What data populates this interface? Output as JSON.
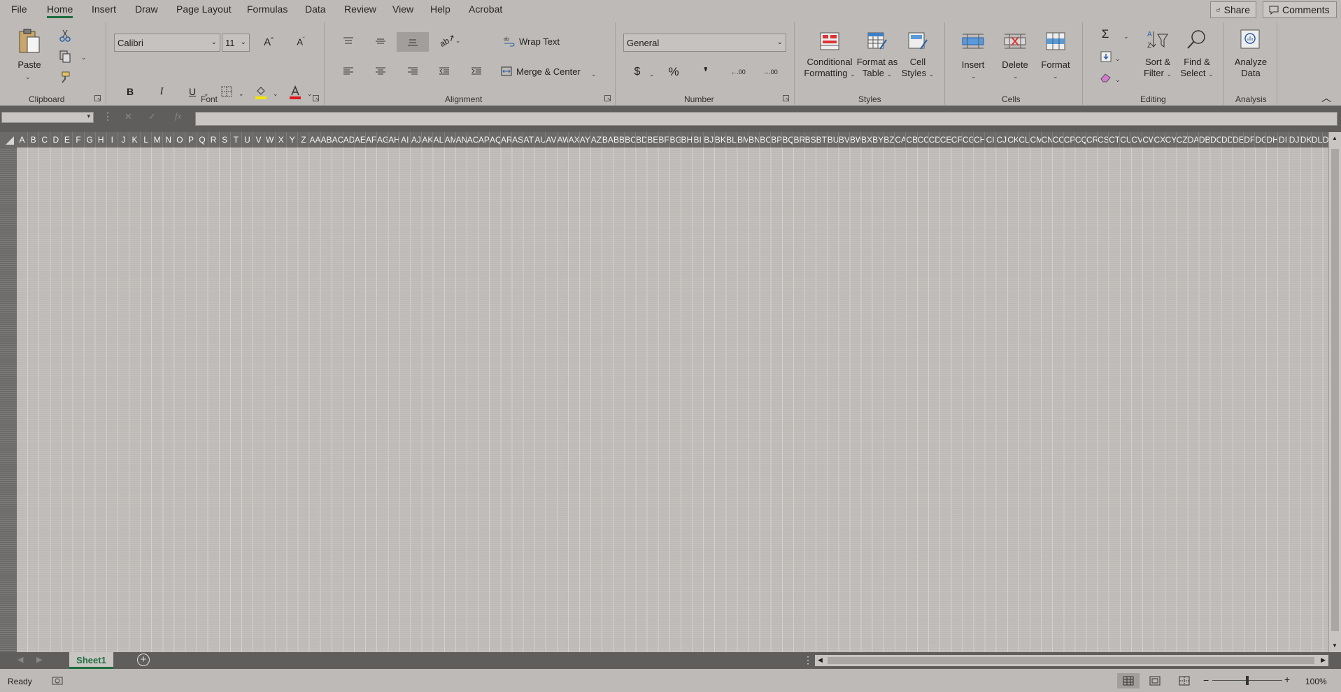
{
  "menu": {
    "tabs": [
      "File",
      "Home",
      "Insert",
      "Draw",
      "Page Layout",
      "Formulas",
      "Data",
      "Review",
      "View",
      "Help",
      "Acrobat"
    ],
    "share": "Share",
    "comments": "Comments"
  },
  "ribbon": {
    "clipboard": {
      "label": "Clipboard",
      "paste": "Paste"
    },
    "font": {
      "label": "Font",
      "name": "Calibri",
      "size": "11",
      "bold": "B",
      "italic": "I",
      "underline": "U",
      "highlight_color": "#f2e600",
      "font_color": "#e0191c"
    },
    "alignment": {
      "label": "Alignment",
      "wrap_text": "Wrap Text",
      "merge_center": "Merge & Center"
    },
    "number": {
      "label": "Number",
      "format": "General",
      "dollar": "$",
      "percent": "%",
      "comma": "❜",
      "inc_decimal": ".00",
      "dec_decimal": ".00"
    },
    "styles": {
      "label": "Styles",
      "conditional_1": "Conditional",
      "conditional_2": "Formatting",
      "format_table_1": "Format as",
      "format_table_2": "Table",
      "cell_styles_1": "Cell",
      "cell_styles_2": "Styles"
    },
    "cells": {
      "label": "Cells",
      "insert": "Insert",
      "delete": "Delete",
      "format": "Format"
    },
    "editing": {
      "label": "Editing",
      "sum": "Σ",
      "sort_1": "Sort &",
      "sort_2": "Filter",
      "find_1": "Find &",
      "find_2": "Select"
    },
    "analysis": {
      "label": "Analysis",
      "analyze_1": "Analyze",
      "analyze_2": "Data"
    }
  },
  "formula_bar": {
    "fx": "fx",
    "name_box": "",
    "formula": ""
  },
  "grid": {
    "columns": [
      "A",
      "B",
      "C",
      "D",
      "E",
      "F",
      "G",
      "H",
      "I",
      "J",
      "K",
      "L",
      "M",
      "N",
      "O",
      "P",
      "Q",
      "R",
      "S",
      "T",
      "U",
      "V",
      "W",
      "X",
      "Y",
      "Z",
      "AA",
      "AB",
      "AC",
      "AD",
      "AE",
      "AF",
      "AG",
      "AH",
      "AI",
      "AJ",
      "AK",
      "AL",
      "AM",
      "AN",
      "AO",
      "AP",
      "AQ",
      "AR",
      "AS",
      "AT",
      "AU",
      "AV",
      "AW",
      "AX",
      "AY",
      "AZ",
      "BA",
      "BB",
      "BC",
      "BD",
      "BE",
      "BF",
      "BG",
      "BH",
      "BI",
      "BJ",
      "BK",
      "BL",
      "BM",
      "BN",
      "BO",
      "BP",
      "BQ",
      "BR",
      "BS",
      "BT",
      "BU",
      "BV",
      "BW",
      "BX",
      "BY",
      "BZ",
      "CA",
      "CB",
      "CC",
      "CD",
      "CE",
      "CF",
      "CG",
      "CH",
      "CI",
      "CJ",
      "CK",
      "CL",
      "CM",
      "CN",
      "CO",
      "CP",
      "CQ",
      "CR",
      "CS",
      "CT",
      "CU",
      "CV",
      "CW",
      "CX",
      "CY",
      "CZ",
      "DA",
      "DB",
      "DC",
      "DD",
      "DE",
      "DF",
      "DG",
      "DH",
      "DI",
      "DJ",
      "DK",
      "DL",
      "DM"
    ]
  },
  "sheets": {
    "active": "Sheet1"
  },
  "status": {
    "state": "Ready",
    "zoom": "100%",
    "minus": "−",
    "plus": "+",
    "zoom_level": 0.5
  },
  "colors": {
    "accent": "#1e6e3f",
    "background": "#bdbab7",
    "dark_chrome": "#5f5e5c"
  }
}
